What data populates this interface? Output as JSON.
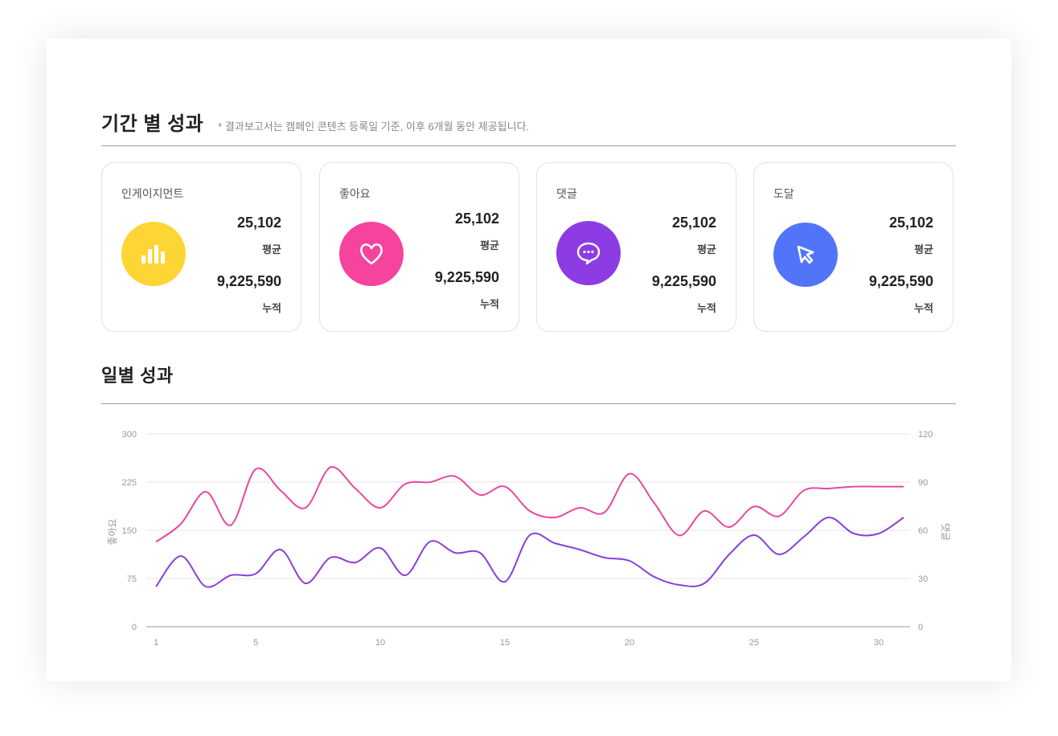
{
  "period_section": {
    "title": "기간 별 성과",
    "note": "* 결과보고서는 캠페인 콘텐츠 등록일 기준, 이후 6개월 동안 제공됩니다."
  },
  "cards": [
    {
      "label": "인게이지먼트",
      "average": "25,102",
      "average_label": "평균",
      "total": "9,225,590",
      "total_label": "누적",
      "icon": "bar-chart-icon",
      "color": "#FDD535"
    },
    {
      "label": "좋아요",
      "average": "25,102",
      "average_label": "평균",
      "total": "9,225,590",
      "total_label": "누적",
      "icon": "heart-icon",
      "color": "#F6439D"
    },
    {
      "label": "댓글",
      "average": "25,102",
      "average_label": "평균",
      "total": "9,225,590",
      "total_label": "누적",
      "icon": "comment-icon",
      "color": "#8C3CE2"
    },
    {
      "label": "도달",
      "average": "25,102",
      "average_label": "평균",
      "total": "9,225,590",
      "total_label": "누적",
      "icon": "cursor-icon",
      "color": "#5174F9"
    }
  ],
  "daily_section": {
    "title": "일별 성과"
  },
  "chart_data": {
    "type": "line",
    "x": [
      1,
      2,
      3,
      4,
      5,
      6,
      7,
      8,
      9,
      10,
      11,
      12,
      13,
      14,
      15,
      16,
      17,
      18,
      19,
      20,
      21,
      22,
      23,
      24,
      25,
      26,
      27,
      28,
      29,
      30,
      31
    ],
    "ylabel_left": "좋아요",
    "ylabel_right": "댓글",
    "ylim_left": [
      0,
      300
    ],
    "ylim_right": [
      0,
      120
    ],
    "yticks_left": [
      0,
      75,
      150,
      225,
      300
    ],
    "yticks_right": [
      0,
      30,
      60,
      90,
      120
    ],
    "xticks": [
      1,
      5,
      10,
      15,
      20,
      25,
      30
    ],
    "grid": true,
    "series": [
      {
        "name": "좋아요",
        "axis": "left",
        "color": "#E8489E",
        "values": [
          132,
          160,
          210,
          158,
          245,
          212,
          185,
          248,
          215,
          185,
          222,
          225,
          234,
          205,
          218,
          180,
          170,
          185,
          178,
          238,
          192,
          142,
          180,
          155,
          187,
          172,
          212,
          215,
          218,
          218,
          218
        ]
      },
      {
        "name": "댓글",
        "axis": "right",
        "color": "#8A3FD8",
        "values": [
          25,
          44,
          25,
          32,
          33,
          48,
          27,
          43,
          40,
          49,
          32,
          53,
          46,
          46,
          28,
          57,
          52,
          48,
          43,
          41,
          31,
          26,
          27,
          45,
          57,
          45,
          56,
          68,
          58,
          58,
          68
        ]
      }
    ]
  }
}
